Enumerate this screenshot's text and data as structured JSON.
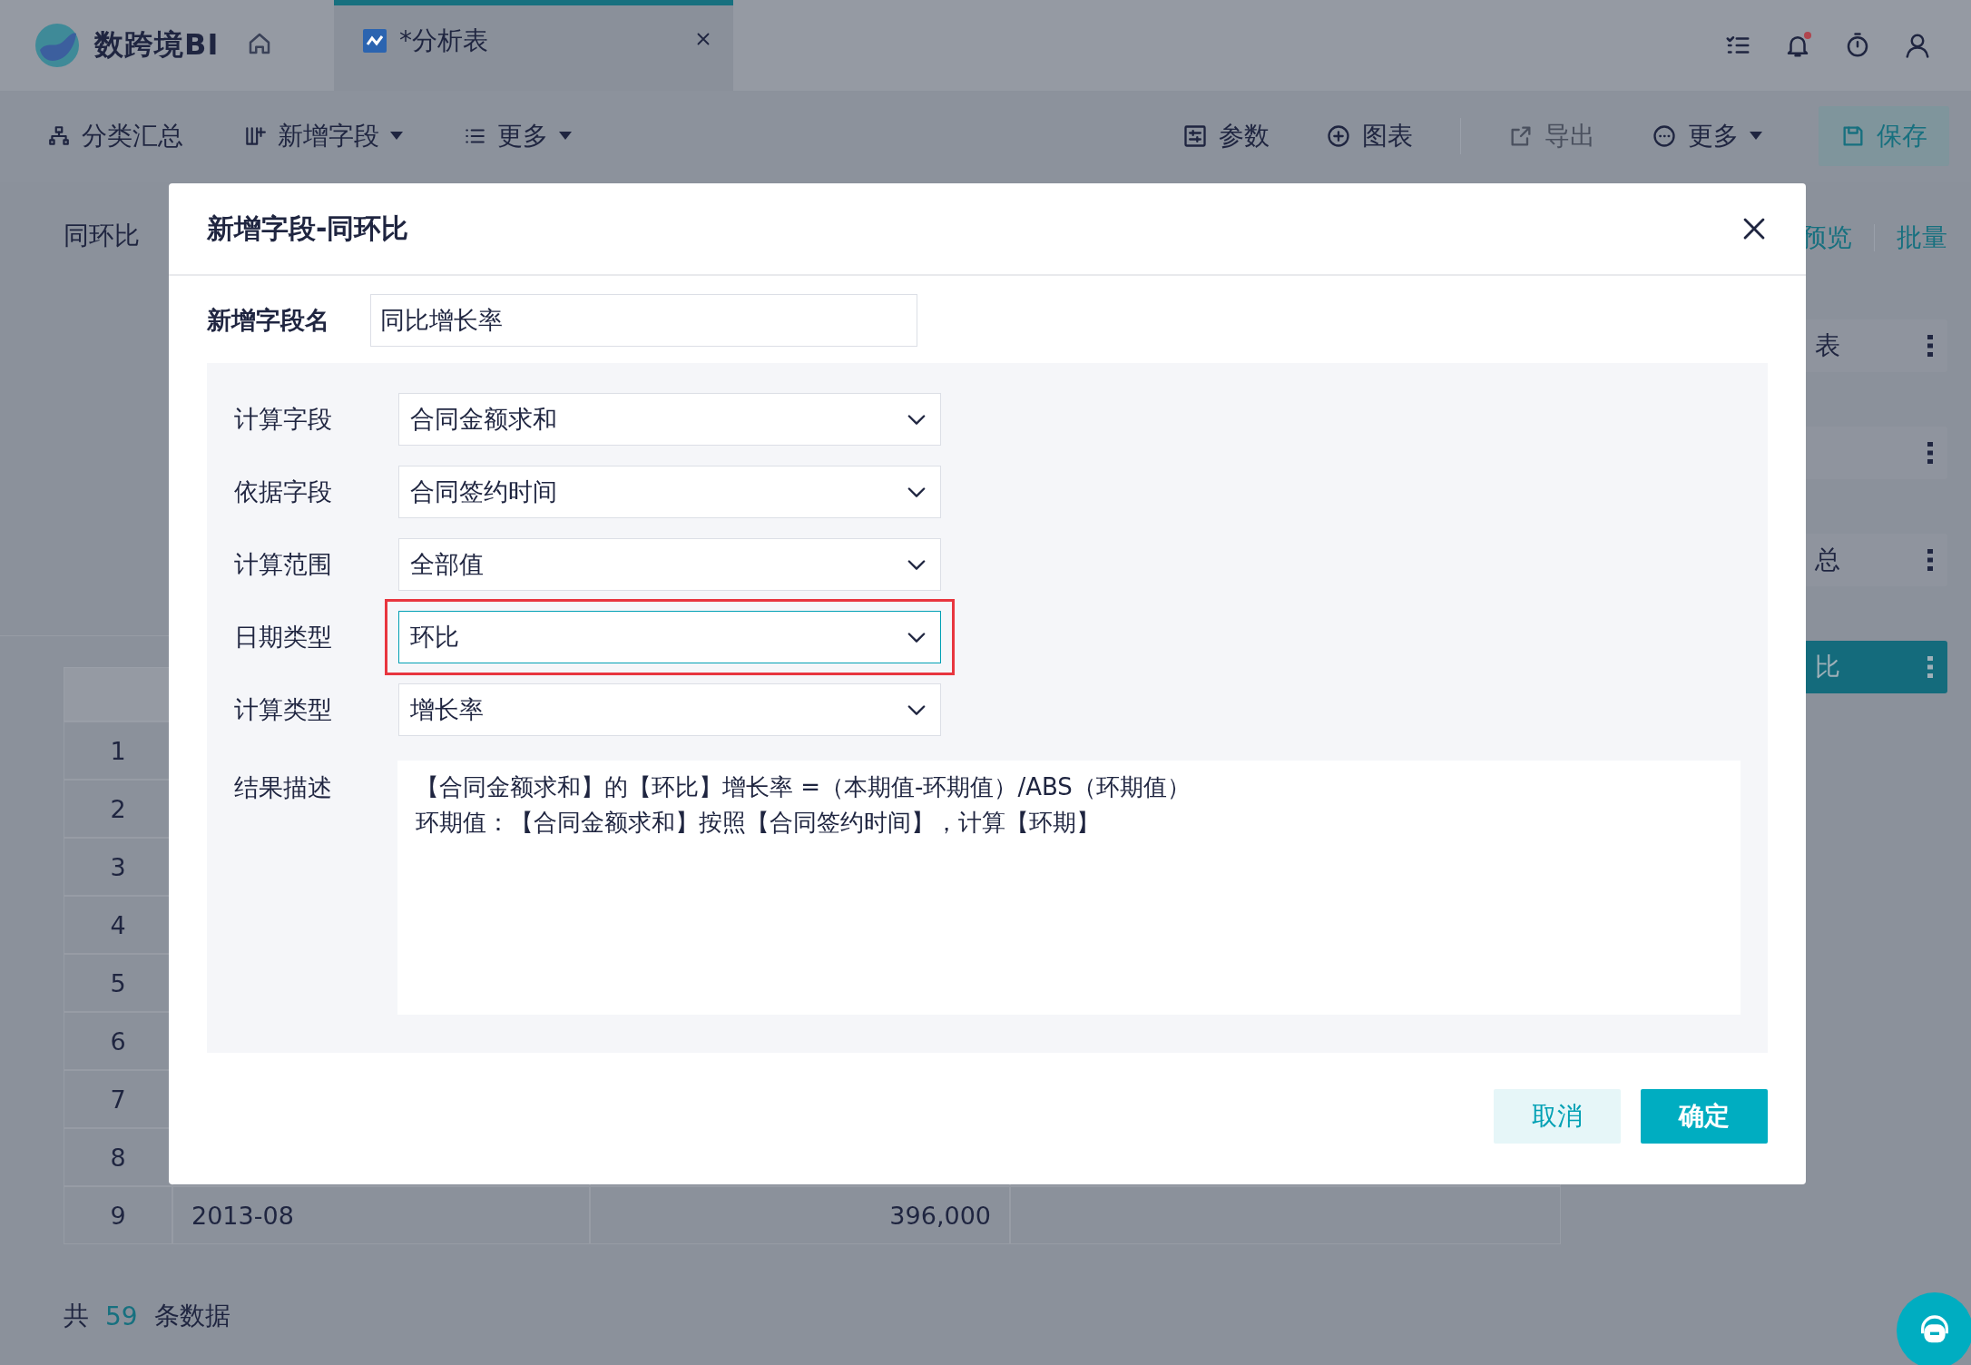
{
  "app": {
    "logo_text": "数跨境BI"
  },
  "tabs": [
    {
      "label": "*分析表",
      "selected": true
    }
  ],
  "toolbar_left": [
    {
      "label": "分类汇总",
      "kind": "button"
    },
    {
      "label": "新增字段",
      "kind": "dropdown"
    },
    {
      "label": "更多",
      "kind": "dropdown"
    }
  ],
  "toolbar_right": [
    {
      "label": "参数",
      "kind": "button",
      "disabled": false
    },
    {
      "label": "图表",
      "kind": "button",
      "disabled": false
    },
    {
      "label": "导出",
      "kind": "button",
      "disabled": true
    },
    {
      "label": "更多",
      "kind": "dropdown",
      "disabled": false
    },
    {
      "label": "保存",
      "kind": "primary",
      "disabled": false
    }
  ],
  "left_tab": {
    "label": "同环比"
  },
  "right_panel": {
    "actions": [
      "预览",
      "批量"
    ],
    "items": [
      {
        "label": "表",
        "selected": false
      },
      {
        "selected": false
      },
      {
        "label": "总",
        "selected": false
      },
      {
        "label": "比",
        "selected": true
      }
    ]
  },
  "table": {
    "rows": [
      {
        "index": "1"
      },
      {
        "index": "2"
      },
      {
        "index": "3"
      },
      {
        "index": "4"
      },
      {
        "index": "5"
      },
      {
        "index": "6"
      },
      {
        "index": "7"
      },
      {
        "index": "8"
      },
      {
        "index": "9",
        "cells": [
          "2013-08",
          "396,000"
        ]
      }
    ]
  },
  "footer": {
    "prefix": "共",
    "count": "59",
    "suffix": "条数据"
  },
  "dialog": {
    "title": "新增字段-同环比",
    "name_field": {
      "label": "新增字段名",
      "value": "同比增长率"
    },
    "form": [
      {
        "label": "计算字段",
        "value": "合同金额求和",
        "focused": false,
        "highlighted": false
      },
      {
        "label": "依据字段",
        "value": "合同签约时间",
        "focused": false,
        "highlighted": false
      },
      {
        "label": "计算范围",
        "value": "全部值",
        "focused": false,
        "highlighted": false
      },
      {
        "label": "日期类型",
        "value": "环比",
        "focused": true,
        "highlighted": true
      },
      {
        "label": "计算类型",
        "value": "增长率",
        "focused": false,
        "highlighted": false
      }
    ],
    "description": {
      "label": "结果描述",
      "lines": [
        "【合同金额求和】的【环比】增长率 =（本期值-环期值）/ABS（环期值）",
        "环期值：【合同金额求和】按照【合同签约时间】，计算【环期】"
      ]
    },
    "buttons": [
      {
        "label": "取消",
        "kind": "secondary"
      },
      {
        "label": "确定",
        "kind": "primary"
      }
    ]
  }
}
